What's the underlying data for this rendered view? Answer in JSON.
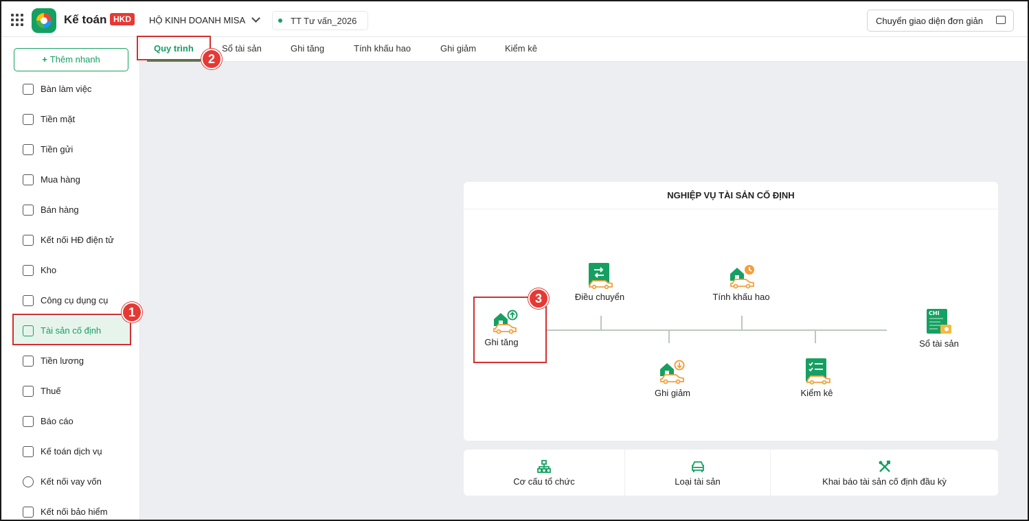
{
  "header": {
    "app_title": "Kế toán",
    "badge": "HKD",
    "company": "HỘ KINH DOANH MISA",
    "workspace": "TT Tư vấn_2026",
    "switch_button": "Chuyển giao diện đơn giản"
  },
  "sidebar": {
    "quick_add": "Thêm nhanh",
    "items": [
      {
        "label": "Bàn làm việc",
        "icon": "dashboard-icon"
      },
      {
        "label": "Tiền mặt",
        "icon": "wallet-icon"
      },
      {
        "label": "Tiền gửi",
        "icon": "card-icon"
      },
      {
        "label": "Mua hàng",
        "icon": "cart-icon"
      },
      {
        "label": "Bán hàng",
        "icon": "tag-icon"
      },
      {
        "label": "Kết nối HĐ điện tử",
        "icon": "invoice-icon"
      },
      {
        "label": "Kho",
        "icon": "box-icon"
      },
      {
        "label": "Công cụ dụng cụ",
        "icon": "wrench-icon"
      },
      {
        "label": "Tài sản cố định",
        "icon": "car-icon"
      },
      {
        "label": "Tiền lương",
        "icon": "money-icon"
      },
      {
        "label": "Thuế",
        "icon": "receipt-icon"
      },
      {
        "label": "Báo cáo",
        "icon": "chart-icon"
      },
      {
        "label": "Kế toán dịch vụ",
        "icon": "briefcase-icon"
      },
      {
        "label": "Kết nối vay vốn",
        "icon": "link-icon"
      },
      {
        "label": "Kết nối bảo hiểm",
        "icon": "shield-icon"
      }
    ]
  },
  "tabs": [
    "Quy trình",
    "Sổ tài sản",
    "Ghi tăng",
    "Tính khấu hao",
    "Ghi giảm",
    "Kiểm kê"
  ],
  "process": {
    "title": "NGHIỆP VỤ TÀI SẢN CỐ ĐỊNH",
    "nodes": {
      "ghi_tang": "Ghi tăng",
      "dieu_chuyen": "Điều chuyển",
      "tinh_khau_hao": "Tính khấu hao",
      "ghi_giam": "Ghi giảm",
      "kiem_ke": "Kiểm kê",
      "so_tai_san": "Sổ tài sản"
    },
    "ledger_icon_text": "CHI"
  },
  "shortcuts": [
    "Cơ cấu tổ chức",
    "Loại tài sản",
    "Khai báo tài sản cố định đầu kỳ"
  ],
  "annotations": [
    "1",
    "2",
    "3"
  ],
  "colors": {
    "accent": "#15a062",
    "highlight": "#d32f2f",
    "asset_orange": "#f59e3b"
  }
}
